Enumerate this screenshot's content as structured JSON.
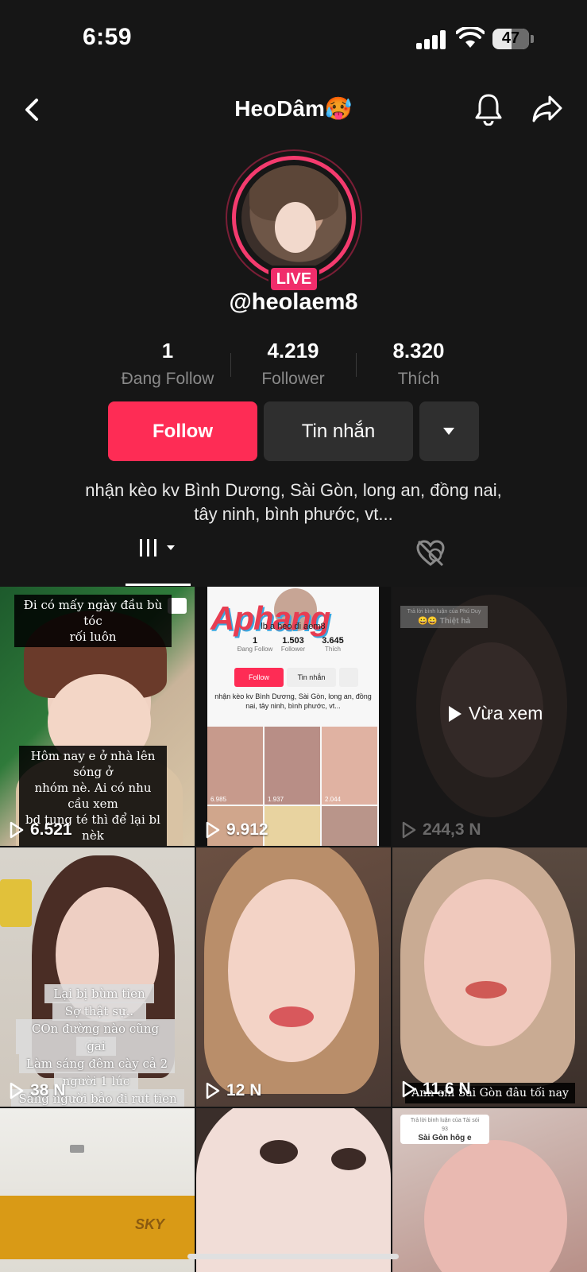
{
  "status_bar": {
    "time": "6:59",
    "battery": "47",
    "battery_level": 0.47
  },
  "header": {
    "title": "HeoDâm🥵"
  },
  "profile": {
    "live_label": "LIVE",
    "username": "@heolaem8",
    "stats": [
      {
        "value": "1",
        "label": "Đang Follow"
      },
      {
        "value": "4.219",
        "label": "Follower"
      },
      {
        "value": "8.320",
        "label": "Thích"
      }
    ],
    "buttons": {
      "follow": "Follow",
      "message": "Tin nhắn"
    },
    "bio_line1": "nhận kèo kv Bình Dương, Sài Gòn, long an, đồng nai,",
    "bio_line2": "tây ninh, bình phước, vt..."
  },
  "grid": {
    "videos": [
      {
        "views": "6.521",
        "caption_top": "Đi có mấy ngày đầu bù tóc",
        "caption_top2": "rối luôn",
        "caption_bottom1": "Hôm nay e ở nhà lên sóng ở",
        "caption_bottom2": "nhóm nè. Ai có nhu cầu xem",
        "caption_bottom3": "bd tung té thì để lại bl nèk"
      },
      {
        "views": "9.912",
        "watermark": "Aphang",
        "mini_name": "lb a heo đi",
        "mini_name2": "aem8",
        "mini_stats": [
          {
            "value": "1",
            "label": "Đang Follow"
          },
          {
            "value": "1.503",
            "label": "Follower"
          },
          {
            "value": "3.645",
            "label": "Thích"
          }
        ],
        "mini_follow": "Follow",
        "mini_msg": "Tin nhắn",
        "mini_bio": "nhận kèo kv Bình Dương, Sài Gòn, long an, đồng nai, tây ninh, bình phước, vt...",
        "mini_views": [
          "6.985",
          "1.937",
          "2.044"
        ]
      },
      {
        "views": "244,3 N",
        "viewed_label": "Vừa xem",
        "reply_small": "Trả lời bình luận của Phú Duy",
        "reply_text": "😀😀 Thiệt hả"
      },
      {
        "views": "38 N",
        "caption1": "Lại bị bùm tien",
        "caption2": "Sợ thật sự..",
        "caption3": "COn đường nào cũng đầy",
        "caption4": "gai",
        "caption5": "Làm sáng đêm cày cả 2",
        "caption6": "người 1 lúc",
        "caption7": "Sáng người bảo đi rut tien",
        "caption8": "Còn người còn lại cày tiếp"
      },
      {
        "views": "12 N"
      },
      {
        "views": "11,6 N",
        "caption": "Anh em Sài Gòn đâu tối nay"
      },
      {
        "brand": "SKY"
      },
      {},
      {
        "reply_small": "Trả lời bình luận của Tài sói 93",
        "reply_text": "Sài Gòn hôg e"
      }
    ]
  },
  "colors": {
    "accent": "#fe2c55",
    "live": "#f02d6b",
    "background": "#161616"
  }
}
